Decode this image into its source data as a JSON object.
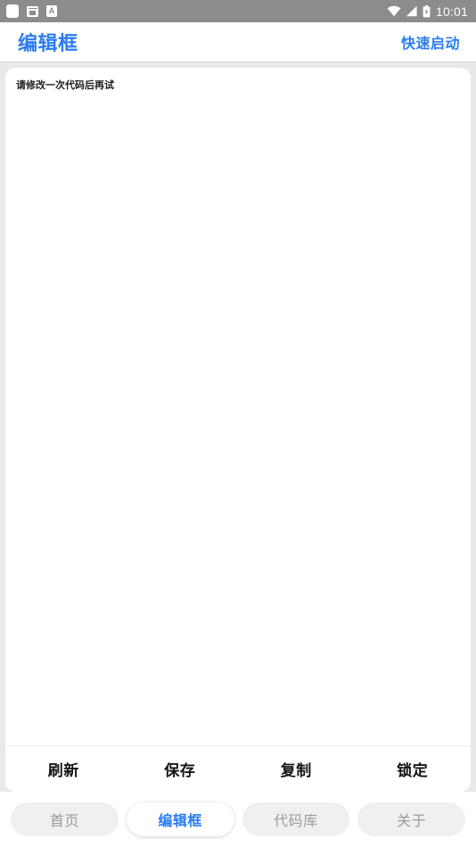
{
  "status_bar": {
    "icons_left": [
      "app-square-icon",
      "mail-icon",
      "translate-a-icon"
    ],
    "a_badge": "A",
    "icons_right": [
      "wifi-icon",
      "signal-icon",
      "battery-charging-icon"
    ],
    "time": "10:01",
    "background": "#8c8c8c"
  },
  "header": {
    "title": "编辑框",
    "action_label": "快速启动",
    "accent_color": "#2b7cf0"
  },
  "editor": {
    "content": "请修改一次代码后再试",
    "placeholder": "请修改一次代码后再试"
  },
  "actions": [
    {
      "label": "刷新",
      "name": "refresh"
    },
    {
      "label": "保存",
      "name": "save"
    },
    {
      "label": "复制",
      "name": "copy"
    },
    {
      "label": "锁定",
      "name": "lock"
    }
  ],
  "tabs": [
    {
      "label": "首页",
      "active": false
    },
    {
      "label": "编辑框",
      "active": true
    },
    {
      "label": "代码库",
      "active": false
    },
    {
      "label": "关于",
      "active": false
    }
  ]
}
